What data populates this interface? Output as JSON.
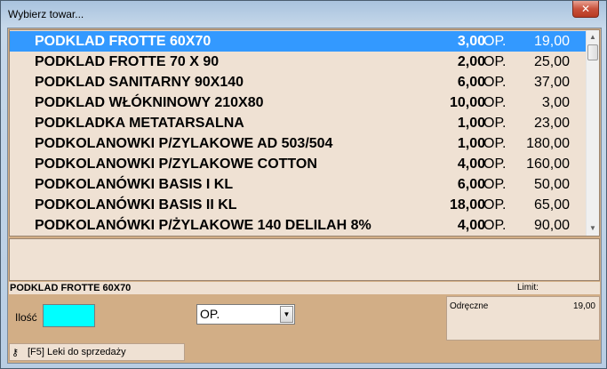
{
  "window": {
    "title": "Wybierz towar..."
  },
  "list": {
    "rows": [
      {
        "name": "PODKLAD FROTTE 60X70",
        "qty": "3,00",
        "unit": "OP.",
        "price": "19,00",
        "selected": true
      },
      {
        "name": "PODKLAD FROTTE 70 X 90",
        "qty": "2,00",
        "unit": "OP.",
        "price": "25,00"
      },
      {
        "name": "PODKLAD SANITARNY 90X140",
        "qty": "6,00",
        "unit": "OP.",
        "price": "37,00"
      },
      {
        "name": "PODKLAD WŁÓKNINOWY 210X80",
        "qty": "10,00",
        "unit": "OP.",
        "price": "3,00"
      },
      {
        "name": "PODKLADKA METATARSALNA",
        "qty": "1,00",
        "unit": "OP.",
        "price": "23,00"
      },
      {
        "name": "PODKOLANOWKI P/ZYLAKOWE AD 503/504",
        "qty": "1,00",
        "unit": "OP.",
        "price": "180,00"
      },
      {
        "name": "PODKOLANOWKI P/ZYLAKOWE COTTON",
        "qty": "4,00",
        "unit": "OP.",
        "price": "160,00"
      },
      {
        "name": "PODKOLANÓWKI BASIS I KL",
        "qty": "6,00",
        "unit": "OP.",
        "price": "50,00"
      },
      {
        "name": "PODKOLANÓWKI BASIS II KL",
        "qty": "18,00",
        "unit": "OP.",
        "price": "65,00"
      },
      {
        "name": "PODKOLANÓWKI P/ŻYLAKOWE 140 DELILAH 8%",
        "qty": "4,00",
        "unit": "OP.",
        "price": "90,00"
      }
    ]
  },
  "info": {
    "product": "PODKLAD FROTTE 60X70",
    "limit_label": "Limit:"
  },
  "form": {
    "qty_label": "Ilość",
    "qty_value": "",
    "unit_value": "OP."
  },
  "price_panel": {
    "label": "Odręczne",
    "value": "19,00"
  },
  "status": {
    "shortcut_text": "[F5] Leki do sprzedaży"
  },
  "colors": {
    "selection": "#3399ff",
    "list_bg": "#efe1d3",
    "panel_bg": "#d2ae86",
    "qty_input": "#00ffff"
  }
}
